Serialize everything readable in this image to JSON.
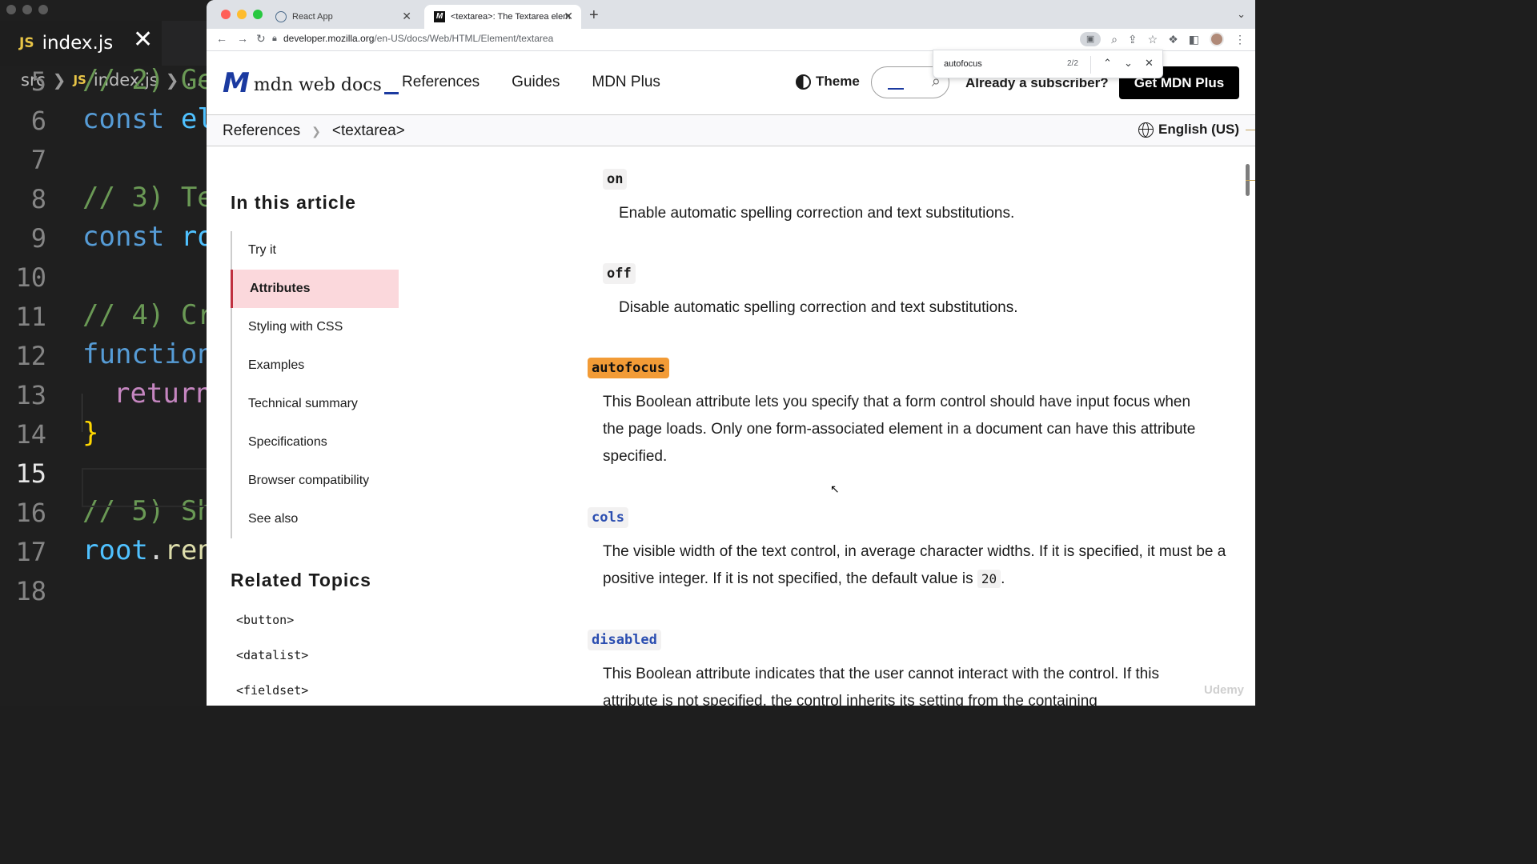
{
  "editor": {
    "tab_label": "index.js",
    "tab_badge": "JS",
    "tab_close": "✕",
    "breadcrumb": {
      "folder": "src",
      "badge": "JS",
      "file": "index.js",
      "more": "..."
    },
    "lines": [
      {
        "n": "5",
        "text": "// 2) Ge",
        "kind": "comment"
      },
      {
        "n": "6",
        "kw": "const",
        "rest": "el"
      },
      {
        "n": "7"
      },
      {
        "n": "8",
        "text": "// 3) Te",
        "kind": "comment"
      },
      {
        "n": "9",
        "kw": "const",
        "rest": "ro"
      },
      {
        "n": "10"
      },
      {
        "n": "11",
        "text": "// 4) Cr",
        "kind": "comment"
      },
      {
        "n": "12",
        "text": "function",
        "kind": "kw"
      },
      {
        "n": "13",
        "text": "return",
        "kind": "ret"
      },
      {
        "n": "14",
        "text": "}",
        "kind": "brace"
      },
      {
        "n": "15"
      },
      {
        "n": "16",
        "text": "// 5) Sh",
        "kind": "comment"
      },
      {
        "n": "17",
        "obj": "root",
        "dot": ".",
        "method": "ren"
      },
      {
        "n": "18"
      }
    ]
  },
  "browser": {
    "tabs": [
      {
        "label": "React App",
        "close": "✕"
      },
      {
        "label": "<textarea>: The Textarea elem",
        "close": "✕"
      }
    ],
    "new_tab": "+",
    "url_host": "developer.mozilla.org",
    "url_path": "/en-US/docs/Web/HTML/Element/textarea",
    "find": {
      "query": "autofocus",
      "count": "2/2"
    }
  },
  "mdn": {
    "logo_text": "mdn web docs",
    "nav": [
      "References",
      "Guides",
      "MDN Plus"
    ],
    "theme_label": "Theme",
    "subscriber_label": "Already a subscriber?",
    "cta_label": "Get MDN Plus",
    "breadcrumb": [
      "References",
      "<textarea>"
    ],
    "language": "English (US)"
  },
  "sidebar": {
    "toc_title": "In this article",
    "toc": [
      "Try it",
      "Attributes",
      "Styling with CSS",
      "Examples",
      "Technical summary",
      "Specifications",
      "Browser compatibility",
      "See also"
    ],
    "active_index": 1,
    "related_title": "Related Topics",
    "related": [
      "<button>",
      "<datalist>",
      "<fieldset>"
    ]
  },
  "article": {
    "on_code": "on",
    "on_desc": "Enable automatic spelling correction and text substitutions.",
    "off_code": "off",
    "off_desc": "Disable automatic spelling correction and text substitutions.",
    "autofocus_code": "autofocus",
    "autofocus_desc": "This Boolean attribute lets you specify that a form control should have input focus when the page loads. Only one form-associated element in a document can have this attribute specified.",
    "cols_code": "cols",
    "cols_desc_before": "The visible width of the text control, in average character widths. If it is specified, it must be a positive integer. If it is not specified, the default value is ",
    "cols_default": "20",
    "cols_desc_after": ".",
    "disabled_code": "disabled",
    "disabled_desc": "This Boolean attribute indicates that the user cannot interact with the control. If this attribute is not specified, the control inherits its setting from the containing"
  },
  "watermark": "Udemy"
}
